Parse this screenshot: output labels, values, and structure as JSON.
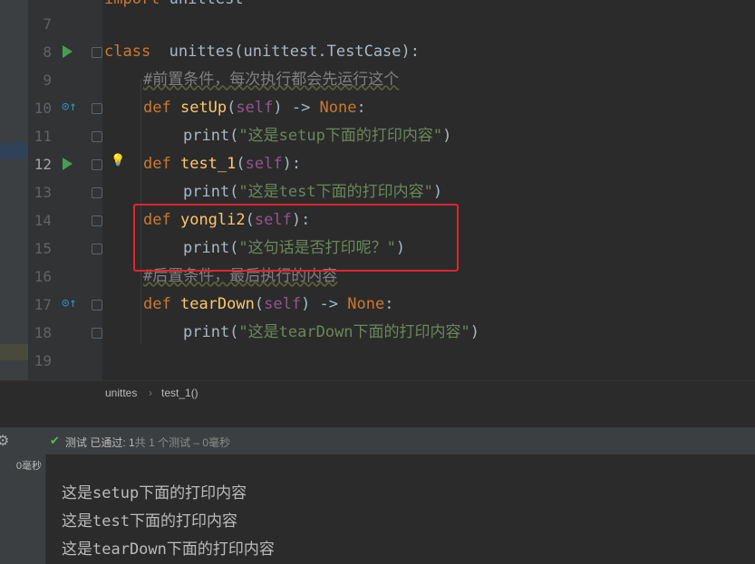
{
  "editor": {
    "top_partial": "import unittest",
    "lines": [
      {
        "num": "7",
        "code": ""
      },
      {
        "num": "8",
        "code": "class  unittes(unittest.TestCase):"
      },
      {
        "num": "9",
        "code": "#前置条件，每次执行都会先运行这个"
      },
      {
        "num": "10",
        "code": "def setUp(self) -> None:"
      },
      {
        "num": "11",
        "code": "print(\"这是setup下面的打印内容\")"
      },
      {
        "num": "12",
        "code": "def test_1(self):"
      },
      {
        "num": "13",
        "code": "print(\"这是test下面的打印内容\")"
      },
      {
        "num": "14",
        "code": "def yongli2(self):"
      },
      {
        "num": "15",
        "code": "print(\"这句话是否打印呢？\")"
      },
      {
        "num": "16",
        "code": "#后置条件，最后执行的内容"
      },
      {
        "num": "17",
        "code": "def tearDown(self) -> None:"
      },
      {
        "num": "18",
        "code": "print(\"这是tearDown下面的打印内容\")"
      },
      {
        "num": "19",
        "code": ""
      }
    ]
  },
  "breadcrumb": {
    "class_name": "unittes",
    "method_name": "test_1()"
  },
  "test_toolbar": {
    "label": "测试",
    "passed_label": "已通过:",
    "passed_count": "1",
    "summary": "共 1 个测试 – 0毫秒"
  },
  "test_tree": {
    "duration": "0毫秒"
  },
  "console": {
    "lines": [
      "这是setup下面的打印内容",
      "这是test下面的打印内容",
      "这是tearDown下面的打印内容"
    ]
  },
  "colors": {
    "keyword": "#cc7832",
    "function": "#ffc66d",
    "self": "#94558d",
    "string": "#6a8759",
    "comment": "#808080",
    "highlight_box": "#e0252e",
    "run_icon": "#499c54"
  },
  "icons": [
    "run-icon",
    "override-icon",
    "fold-icon",
    "lightbulb-icon",
    "gear-icon",
    "check-icon"
  ]
}
